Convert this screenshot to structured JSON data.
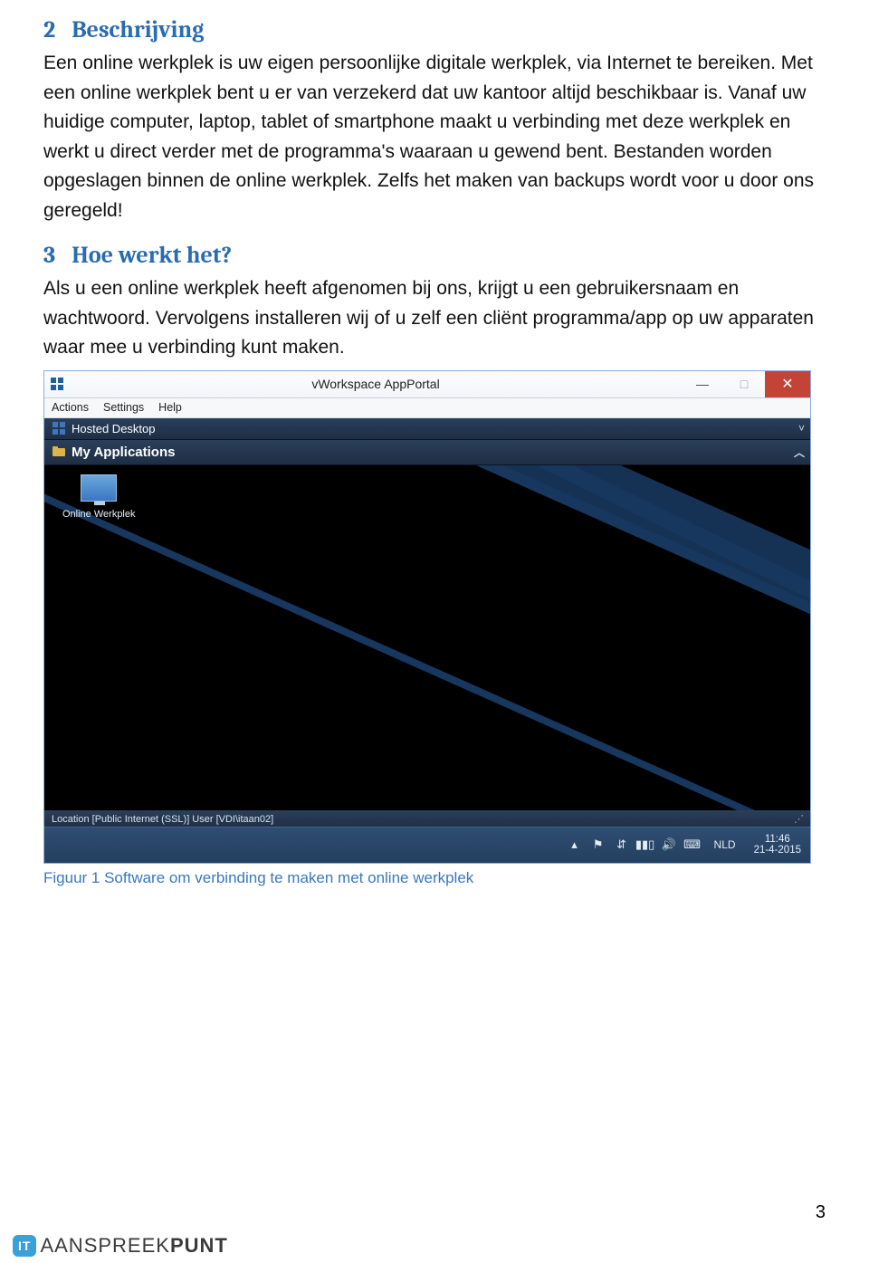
{
  "section2": {
    "num": "2",
    "title": "Beschrijving",
    "body": "Een online werkplek is uw eigen persoonlijke digitale werkplek, via Internet te bereiken. Met een online werkplek bent u er van verzekerd dat uw kantoor altijd beschikbaar is. Vanaf uw huidige computer, laptop, tablet of smartphone maakt u verbinding met deze werkplek en werkt u direct verder met de programma's waaraan u gewend bent. Bestanden worden opgeslagen binnen de online werkplek. Zelfs het maken van backups wordt voor u door ons geregeld!"
  },
  "section3": {
    "num": "3",
    "title": "Hoe werkt het?",
    "body": "Als u een online werkplek heeft afgenomen bij ons, krijgt u een gebruikersnaam en wachtwoord. Vervolgens installeren wij of u zelf een cliënt programma/app op uw apparaten waar mee u verbinding kunt maken."
  },
  "screenshot": {
    "window": {
      "title": "vWorkspace AppPortal",
      "menu": {
        "actions": "Actions",
        "settings": "Settings",
        "help": "Help"
      },
      "band_hosted": "Hosted Desktop",
      "band_apps": "My Applications",
      "app_tile": "Online Werkplek",
      "status": "Location [Public Internet (SSL)]  User [VDI\\itaan02]",
      "chev_down": "˅",
      "chev_up": "︿",
      "minimize": "—",
      "maximize": "□",
      "close": "✕"
    },
    "taskbar": {
      "tray_up": "▴",
      "flag": "⚑",
      "device": "⇵",
      "signal": "▮▮▯",
      "sound": "🔊",
      "keyboard": "⌨",
      "lang": "NLD",
      "time": "11:46",
      "date": "21-4-2015"
    },
    "caption": "Figuur 1 Software om verbinding te maken met online werkplek"
  },
  "page_number": "3",
  "footer": {
    "badge": "IT",
    "brand_light": "AANSPREEK",
    "brand_bold": "PUNT"
  }
}
